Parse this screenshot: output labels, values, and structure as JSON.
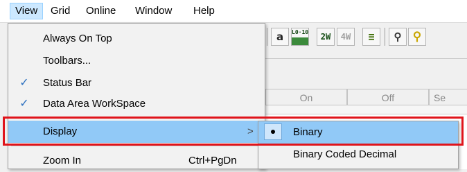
{
  "menubar": {
    "items": [
      {
        "label": "View"
      },
      {
        "label": "Grid"
      },
      {
        "label": "Online"
      },
      {
        "label": "Window"
      },
      {
        "label": "Help"
      }
    ]
  },
  "toolbar": {
    "buttons": [
      {
        "icon": "font-a-icon",
        "text": "a"
      },
      {
        "icon": "ladder-lo-icon",
        "text": "L0·10"
      },
      {
        "icon": "2w-icon",
        "text": "2W"
      },
      {
        "icon": "4w-icon",
        "text": "4W"
      },
      {
        "icon": "list-icon",
        "text": "≡"
      },
      {
        "icon": "search-icon",
        "text": "⚲"
      },
      {
        "icon": "zoom-icon",
        "text": "⚲"
      }
    ]
  },
  "grid": {
    "headers": [
      "On",
      "Off",
      "Se"
    ]
  },
  "view_menu": {
    "items": [
      {
        "label": "Always On Top",
        "checked": false
      },
      {
        "label": "Toolbars...",
        "checked": false
      },
      {
        "label": "Status Bar",
        "checked": true
      },
      {
        "label": "Data Area WorkSpace",
        "checked": true
      },
      {
        "label": "Display",
        "submenu_arrow": ">",
        "highlighted": true
      },
      {
        "label": "Zoom In",
        "shortcut": "Ctrl+PgDn"
      }
    ],
    "check_glyph": "✓"
  },
  "display_submenu": {
    "items": [
      {
        "label": "Binary",
        "selected": true,
        "highlighted": true
      },
      {
        "label": "Binary Coded Decimal",
        "selected": false
      }
    ]
  },
  "colors": {
    "highlight": "#91c9f7",
    "annotation": "#e0141b",
    "check": "#2a6fbf"
  }
}
